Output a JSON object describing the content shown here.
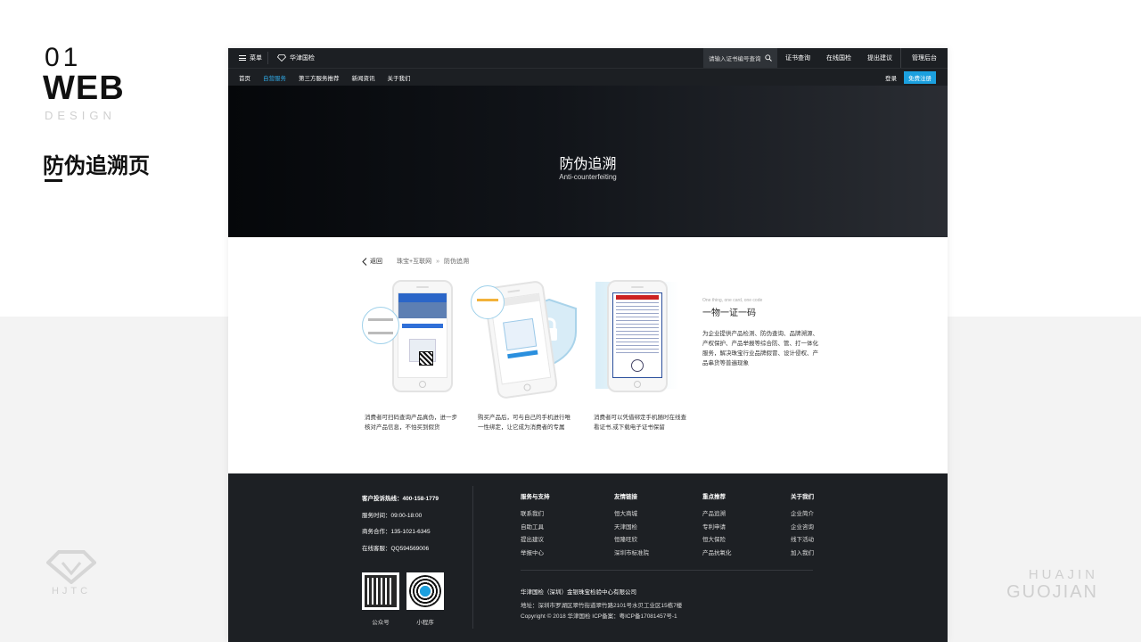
{
  "presentation": {
    "number": "01",
    "web": "WEB",
    "design": "DESIGN",
    "page_title": "防伪追溯页",
    "brand_left": "HJTC",
    "brand_right_1": "HUAJIN",
    "brand_right_2": "GUOJIAN"
  },
  "topbar": {
    "menu_label": "菜单",
    "logo_text": "华津国检",
    "search_placeholder": "请输入证书编号查询",
    "links": [
      "证书查询",
      "在线国检",
      "提出建议"
    ],
    "admin": "管理后台"
  },
  "nav": {
    "items": [
      "首页",
      "自营服务",
      "第三方服务推荐",
      "新闻资讯",
      "关于我们"
    ],
    "active_index": 1,
    "login": "登录",
    "register": "免费注册"
  },
  "hero": {
    "title": "防伪追溯",
    "subtitle": "Anti-counterfeiting"
  },
  "breadcrumb": {
    "back": "返回",
    "level1": "珠宝+互联网",
    "sep": "»",
    "level2": "防伪追溯"
  },
  "steps": [
    {
      "caption": "消费者可扫码查询产品真伪，进一步核对产品信息，不怕买到假货"
    },
    {
      "caption": "购买产品后，可与自己的手机进行唯一性绑定，让它成为消费者的专属"
    },
    {
      "caption": "消费者可以凭借绑定手机随时在线查看证书,或下载电子证书保留"
    }
  ],
  "feature": {
    "small": "One thing, one card, one code",
    "heading": "一物一证一码",
    "description": "为企业提供产品检测、防伪查询、品牌溯源、产权保护、产品举报等综合防、管、打一体化服务，解决珠宝行业品牌假冒、设计侵权、产品串货等普遍现象"
  },
  "footer": {
    "hotline": "客户投诉热线：400-158-1779",
    "hours": "服务时间：09:00-18:00",
    "business": "商务合作：135-1021-6345",
    "online": "在线客服：QQ594569006",
    "columns": [
      {
        "title": "服务与支持",
        "items": [
          "联系我们",
          "自助工具",
          "提出建议",
          "举报中心"
        ]
      },
      {
        "title": "友情链接",
        "items": [
          "恒大商城",
          "天津国检",
          "恒隆旺欣",
          "深圳市标准院"
        ]
      },
      {
        "title": "重点推荐",
        "items": [
          "产品追溯",
          "专利申请",
          "恒大保险",
          "产品抗氧化"
        ]
      },
      {
        "title": "关于我们",
        "items": [
          "企业简介",
          "企业咨询",
          "线下活动",
          "加入我们"
        ]
      }
    ],
    "company_name": "华津国检（深圳）金银珠宝检验中心有限公司",
    "address": "地址：深圳市罗湖区翠竹街道翠竹路2101号水贝工业区15栋7楼",
    "copyright": "Copyright © 2018 华津国检  ICP备案：粤ICP备17081457号-1",
    "qr1_label": "公众号",
    "qr2_label": "小程序"
  },
  "colors": {
    "accent": "#1ba0df",
    "dark": "#1c1f23",
    "footer": "#1d2024"
  }
}
